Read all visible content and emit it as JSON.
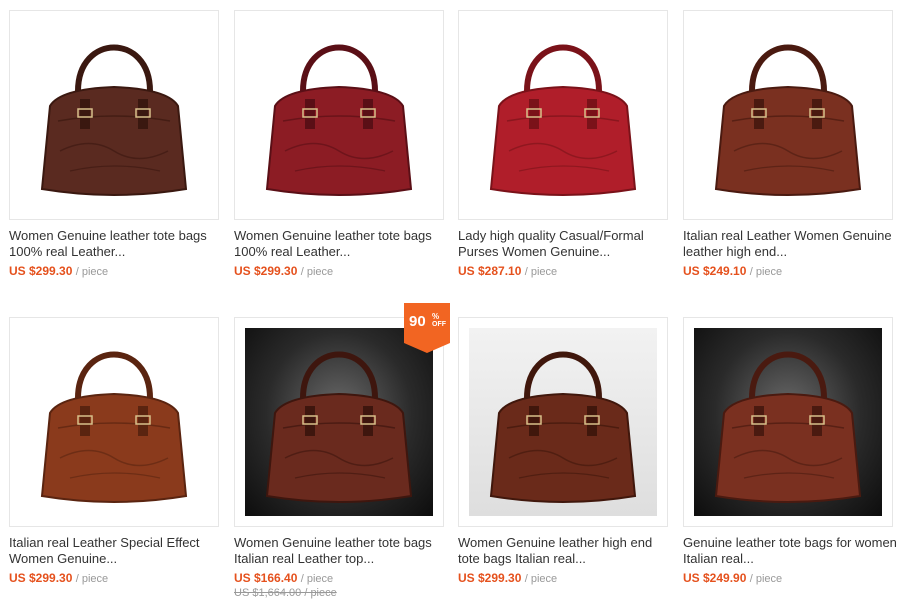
{
  "colors": {
    "price": "#e5511d",
    "badge": "#f26522"
  },
  "products": [
    {
      "title": "Women Genuine leather tote bags 100% real Leather...",
      "price": "US $299.30",
      "unit": "/ piece",
      "bag_color": "#5a2a20",
      "bag_dark": "#3a1810",
      "bg": "white"
    },
    {
      "title": "Women Genuine leather tote bags 100% real Leather...",
      "price": "US $299.30",
      "unit": "/ piece",
      "bag_color": "#8c1c24",
      "bag_dark": "#5a0f16",
      "bg": "white"
    },
    {
      "title": "Lady high quality Casual/Formal Purses Women Genuine...",
      "price": "US $287.10",
      "unit": "/ piece",
      "bag_color": "#b01e2a",
      "bag_dark": "#7a1219",
      "bg": "white"
    },
    {
      "title": "Italian real Leather Women Genuine leather high end...",
      "price": "US $249.10",
      "unit": "/ piece",
      "bag_color": "#7a3020",
      "bag_dark": "#4a1a10",
      "bg": "white"
    },
    {
      "title": "Italian real Leather Special Effect Women Genuine...",
      "price": "US $299.30",
      "unit": "/ piece",
      "bag_color": "#8a3a1c",
      "bag_dark": "#5a2410",
      "bg": "white"
    },
    {
      "title": "Women Genuine leather tote bags Italian real Leather top...",
      "price": "US $166.40",
      "unit": "/ piece",
      "old_price": "US $1,664.00 / piece",
      "bag_color": "#6a2a1e",
      "bag_dark": "#3e160e",
      "bg": "dark",
      "badge": {
        "percent": "90",
        "symbol": "%",
        "label": "OFF"
      }
    },
    {
      "title": "Women Genuine leather high end tote bags Italian real...",
      "price": "US $299.30",
      "unit": "/ piece",
      "bag_color": "#6a2a1a",
      "bag_dark": "#40170c",
      "bg": "grey"
    },
    {
      "title": "Genuine leather tote bags for women Italian real...",
      "price": "US $249.90",
      "unit": "/ piece",
      "bag_color": "#7a3020",
      "bag_dark": "#4a1a10",
      "bg": "dark"
    }
  ]
}
